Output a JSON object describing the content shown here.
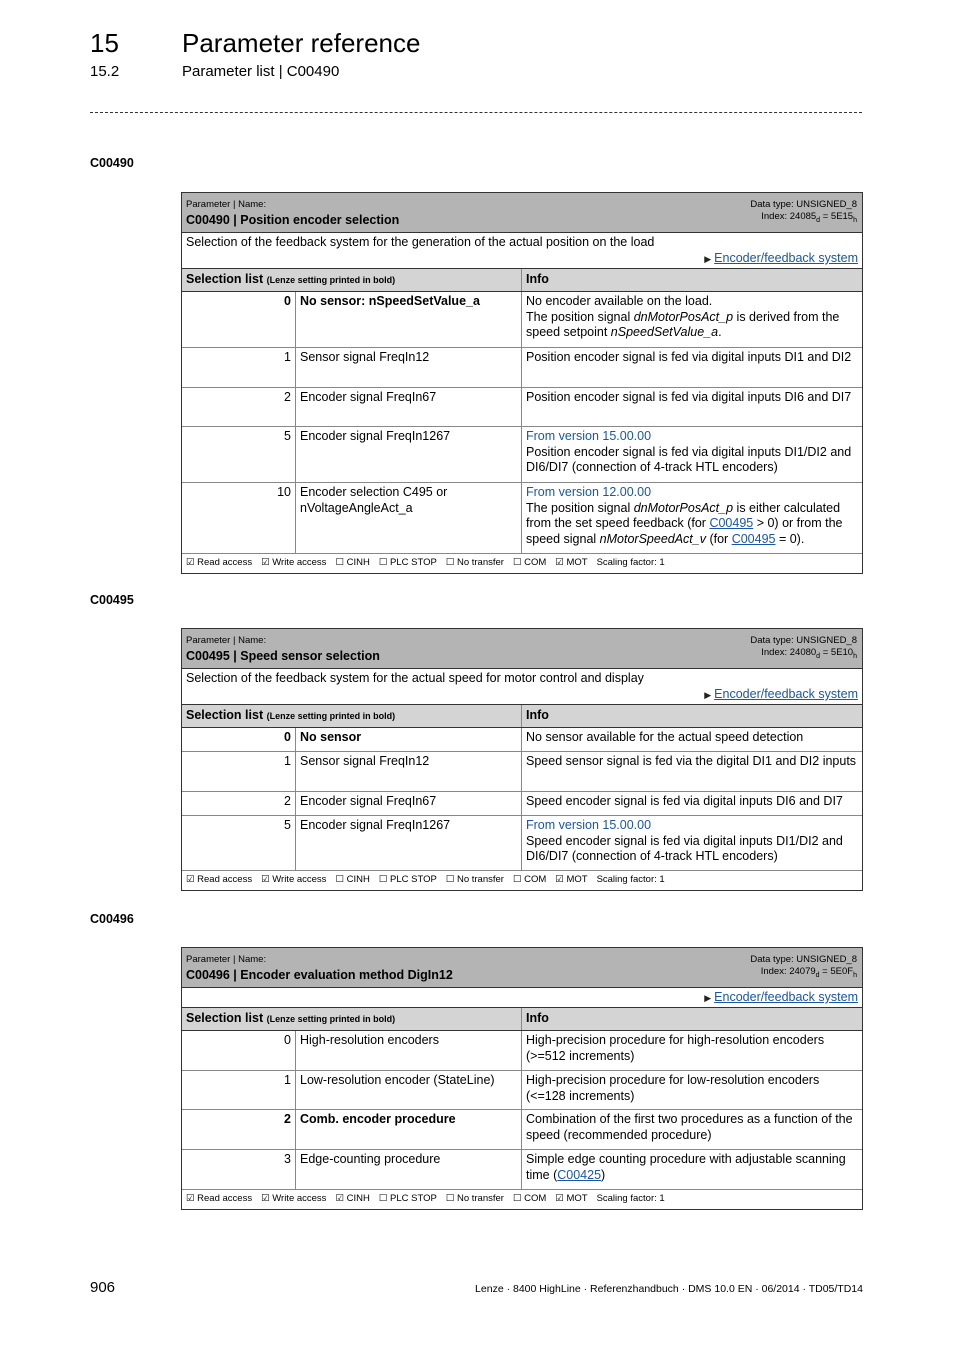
{
  "header": {
    "chapter_number": "15",
    "chapter_title": "Parameter reference",
    "section_number": "15.2",
    "section_title": "Parameter list | C00490"
  },
  "common": {
    "param_label": "Parameter | Name:",
    "selection_list_label": "Selection list",
    "selection_list_note": "(Lenze setting printed in bold)",
    "info_label": "Info",
    "link_label": "Encoder/feedback system",
    "arrow_icon": "▶"
  },
  "params": [
    {
      "anchor": "C00490",
      "name": "C00490 | Position encoder selection",
      "data_type": "Data type: UNSIGNED_8",
      "index_prefix": "Index: 24085",
      "index_sub_d": "d",
      "index_mid": " = 5E15",
      "index_sub_h": "h",
      "description": "Selection of the feedback system for the generation of the actual position on the load",
      "rows": [
        {
          "value": "0",
          "name": "No sensor: nSpeedSetValue_a",
          "bold": true,
          "info_line1": "No encoder available on the load.",
          "info_a": "The position signal ",
          "info_a_italic": "dnMotorPosAct_p",
          "info_b": " is derived from the speed setpoint ",
          "info_b_italic": "nSpeedSetValue_a",
          "info_c": "."
        },
        {
          "value": "1",
          "name": "Sensor signal FreqIn12",
          "info": "Position encoder signal is fed via digital inputs DI1 and DI2"
        },
        {
          "value": "2",
          "name": "Encoder signal FreqIn67",
          "info": "Position encoder signal is fed via digital inputs DI6 and DI7"
        },
        {
          "value": "5",
          "name": "Encoder signal FreqIn1267",
          "version": "From version 15.00.00",
          "info": "Position encoder signal is fed via digital inputs DI1/DI2 and DI6/DI7 (connection of 4-track HTL encoders)"
        },
        {
          "value": "10",
          "name": "Encoder selection C495 or nVoltageAngleAct_a",
          "version": "From version 12.00.00",
          "info_a": "The position signal ",
          "info_a_italic": "dnMotorPosAct_p",
          "info_b": " is either calculated from the set speed feedback (for ",
          "link1": "C00495",
          "info_c": " > 0) or from the speed signal ",
          "info_c_italic": "nMotorSpeedAct_v",
          "info_d": " (for ",
          "link2": "C00495",
          "info_e": " = 0)."
        }
      ],
      "footer": [
        "☑ Read access",
        "☑ Write access",
        "☐ CINH",
        "☐ PLC STOP",
        "☐ No transfer",
        "☐ COM",
        "☑ MOT",
        "Scaling factor: 1"
      ]
    },
    {
      "anchor": "C00495",
      "name": "C00495 | Speed sensor selection",
      "data_type": "Data type: UNSIGNED_8",
      "index_prefix": "Index: 24080",
      "index_sub_d": "d",
      "index_mid": " = 5E10",
      "index_sub_h": "h",
      "description": "Selection of the feedback system for the actual speed for motor control and display",
      "rows": [
        {
          "value": "0",
          "name": "No sensor",
          "bold": true,
          "info": "No sensor available for the actual speed detection"
        },
        {
          "value": "1",
          "name": "Sensor signal FreqIn12",
          "info": "Speed sensor signal is fed via the digital DI1 and DI2 inputs"
        },
        {
          "value": "2",
          "name": "Encoder signal FreqIn67",
          "info": "Speed encoder signal is fed via digital inputs DI6 and DI7"
        },
        {
          "value": "5",
          "name": "Encoder signal FreqIn1267",
          "version": "From version 15.00.00",
          "info": "Speed encoder signal is fed via digital inputs DI1/DI2 and DI6/DI7 (connection of 4-track HTL encoders)"
        }
      ],
      "footer": [
        "☑ Read access",
        "☑ Write access",
        "☐ CINH",
        "☐ PLC STOP",
        "☐ No transfer",
        "☐ COM",
        "☑ MOT",
        "Scaling factor: 1"
      ]
    },
    {
      "anchor": "C00496",
      "name": "C00496 | Encoder evaluation method DigIn12",
      "data_type": "Data type: UNSIGNED_8",
      "index_prefix": "Index: 24079",
      "index_sub_d": "d",
      "index_mid": " = 5E0F",
      "index_sub_h": "h",
      "rows": [
        {
          "value": "0",
          "name": "High-resolution encoders",
          "info": "High-precision procedure for high-resolution encoders (>=512 increments)"
        },
        {
          "value": "1",
          "name": "Low-resolution encoder (StateLine)",
          "info": "High-precision procedure for low-resolution encoders (<=128 increments)"
        },
        {
          "value": "2",
          "name": "Comb. encoder procedure",
          "bold": true,
          "info": "Combination of the first two procedures as a function of the speed (recommended procedure)"
        },
        {
          "value": "3",
          "name": "Edge-counting procedure",
          "info_a": "Simple edge counting procedure with adjustable scanning time (",
          "link1": "C00425",
          "info_b": ")"
        }
      ],
      "footer": [
        "☑ Read access",
        "☑ Write access",
        "☑ CINH",
        "☐ PLC STOP",
        "☐ No transfer",
        "☐ COM",
        "☑ MOT",
        "Scaling factor: 1"
      ]
    }
  ],
  "footer": {
    "page_number": "906",
    "reference": "Lenze · 8400 HighLine · Referenzhandbuch · DMS 10.0 EN · 06/2014 · TD05/TD14"
  }
}
